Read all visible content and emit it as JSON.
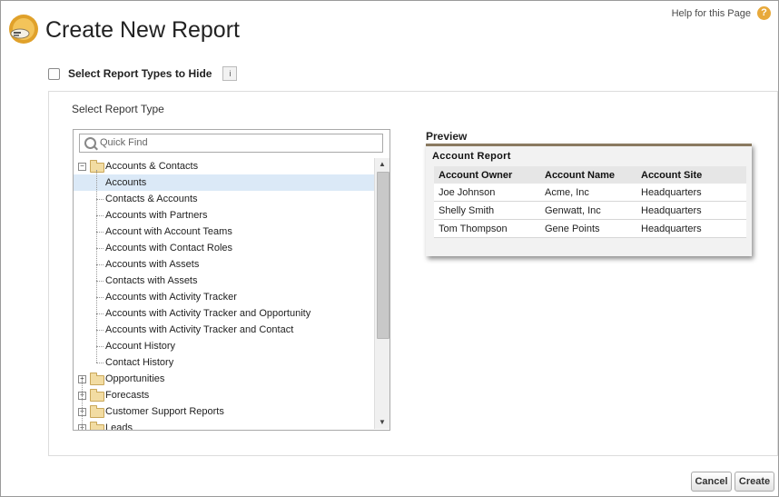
{
  "header": {
    "title": "Create New Report",
    "help_link": "Help for this Page",
    "help_icon": "?"
  },
  "hide_types": {
    "label": "Select Report Types to Hide",
    "info_icon": "i",
    "checked": false
  },
  "selector": {
    "label": "Select Report Type",
    "search_placeholder": "Quick Find",
    "tree": [
      {
        "label": "Accounts & Contacts",
        "type": "folder",
        "expanded": true
      },
      {
        "label": "Accounts",
        "type": "item",
        "selected": true
      },
      {
        "label": "Contacts & Accounts",
        "type": "item"
      },
      {
        "label": "Accounts with Partners",
        "type": "item"
      },
      {
        "label": "Account with Account Teams",
        "type": "item"
      },
      {
        "label": "Accounts with Contact Roles",
        "type": "item"
      },
      {
        "label": "Accounts with Assets",
        "type": "item"
      },
      {
        "label": "Contacts with Assets",
        "type": "item"
      },
      {
        "label": "Accounts with Activity Tracker",
        "type": "item"
      },
      {
        "label": "Accounts with Activity Tracker and Opportunity",
        "type": "item"
      },
      {
        "label": "Accounts with Activity Tracker and Contact",
        "type": "item"
      },
      {
        "label": "Account History",
        "type": "item"
      },
      {
        "label": "Contact History",
        "type": "item"
      },
      {
        "label": "Opportunities",
        "type": "folder",
        "expanded": false
      },
      {
        "label": "Forecasts",
        "type": "folder",
        "expanded": false
      },
      {
        "label": "Customer Support Reports",
        "type": "folder",
        "expanded": false
      },
      {
        "label": "Leads",
        "type": "folder",
        "expanded": false
      }
    ]
  },
  "preview": {
    "label": "Preview",
    "report_title": "Account Report",
    "columns": [
      "Account  Owner",
      "Account Name",
      "Account Site"
    ],
    "rows": [
      [
        "Joe Johnson",
        "Acme, Inc",
        "Headquarters"
      ],
      [
        "Shelly Smith",
        "Genwatt, Inc",
        "Headquarters"
      ],
      [
        "Tom Thompson",
        "Gene Points",
        "Headquarters"
      ]
    ]
  },
  "footer": {
    "cancel_label": "Cancel",
    "create_label": "Create"
  },
  "colors": {
    "selected_row": "#dbe9f7",
    "help_icon": "#e8a93b",
    "folder": "#f2dca2"
  }
}
